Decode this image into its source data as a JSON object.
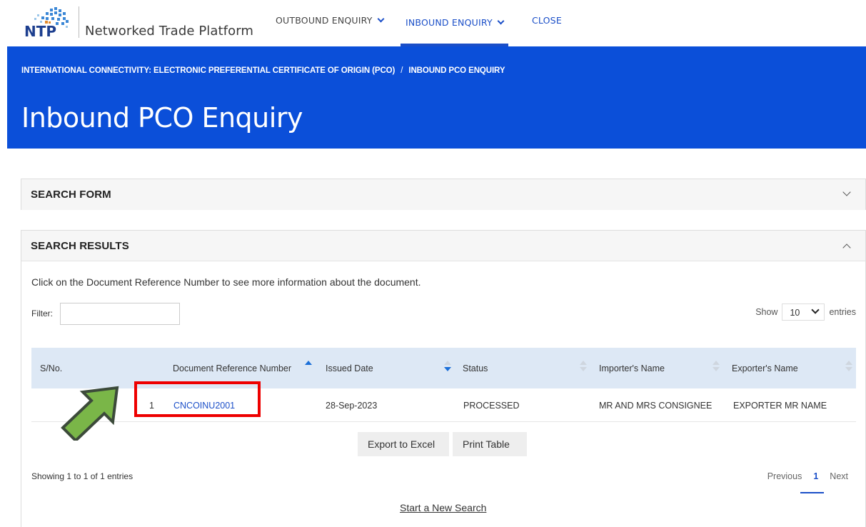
{
  "header": {
    "brand": "Networked Trade Platform",
    "logo_text": "NTP",
    "nav": {
      "outbound": "OUTBOUND ENQUIRY",
      "inbound": "INBOUND ENQUIRY",
      "close": "CLOSE"
    }
  },
  "banner": {
    "breadcrumb_1": "INTERNATIONAL CONNECTIVITY: ELECTRONIC PREFERENTIAL CERTIFICATE OF ORIGIN (PCO)",
    "breadcrumb_sep": "/",
    "breadcrumb_2": "INBOUND PCO ENQUIRY",
    "title": "Inbound PCO Enquiry"
  },
  "search_form": {
    "title": "SEARCH FORM"
  },
  "results": {
    "title": "SEARCH RESULTS",
    "hint": "Click on the Document Reference Number to see more information about the document.",
    "filter_label": "Filter:",
    "filter_value": "",
    "show_label": "Show",
    "show_value": "10",
    "entries_label": "entries",
    "columns": {
      "sno": "S/No.",
      "docref": "Document Reference Number",
      "issued": "Issued Date",
      "status": "Status",
      "importer": "Importer's Name",
      "exporter": "Exporter's Name"
    },
    "rows": [
      {
        "sno": "1",
        "docref": "CNCOINU2001",
        "issued": "28-Sep-2023",
        "status": "PROCESSED",
        "importer": "MR AND MRS CONSIGNEE",
        "exporter": "EXPORTER MR NAME"
      }
    ],
    "export_label": "Export to Excel",
    "print_label": "Print Table",
    "showing": "Showing 1 to 1 of 1 entries",
    "pager": {
      "previous": "Previous",
      "current": "1",
      "next": "Next"
    },
    "new_search": "Start a New Search"
  },
  "colors": {
    "brand_blue": "#0b4fd9",
    "link_blue": "#1b4fc8",
    "header_row": "#dde8f5",
    "highlight_red": "#ee0000",
    "arrow_green": "#7ab648"
  }
}
